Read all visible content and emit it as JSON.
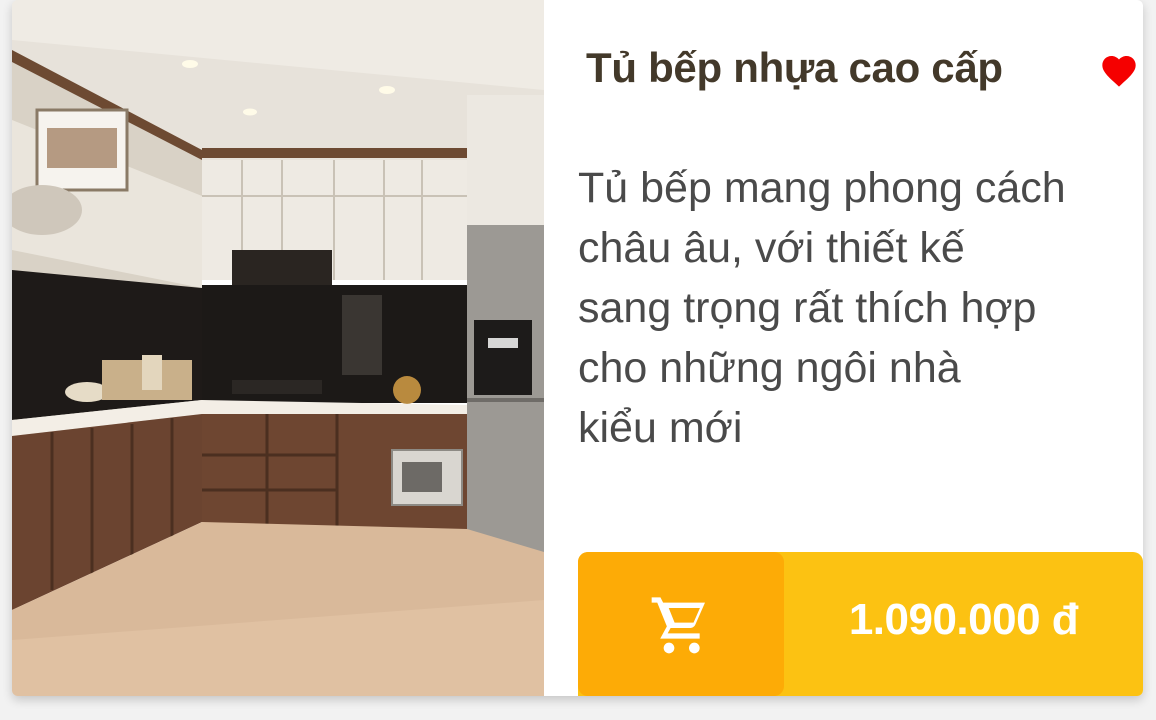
{
  "product": {
    "image": "kitchen-cabinet-photo",
    "title": "Tủ bếp nhựa cao cấp",
    "description": "Tủ bếp mang phong cách\nchâu âu, với thiết kế\nsang trọng rất thích hợp\ncho những ngôi nhà\nkiểu mới",
    "price": "1.090.000 đ",
    "favorited": true
  },
  "icons": {
    "favorite": "heart-icon",
    "cart": "shopping-cart-icon"
  },
  "colors": {
    "heart": "#f50000",
    "price_bar": "#fcc212",
    "cart_button": "#fdab06",
    "title": "#43392a",
    "description": "#4a4a4a"
  }
}
